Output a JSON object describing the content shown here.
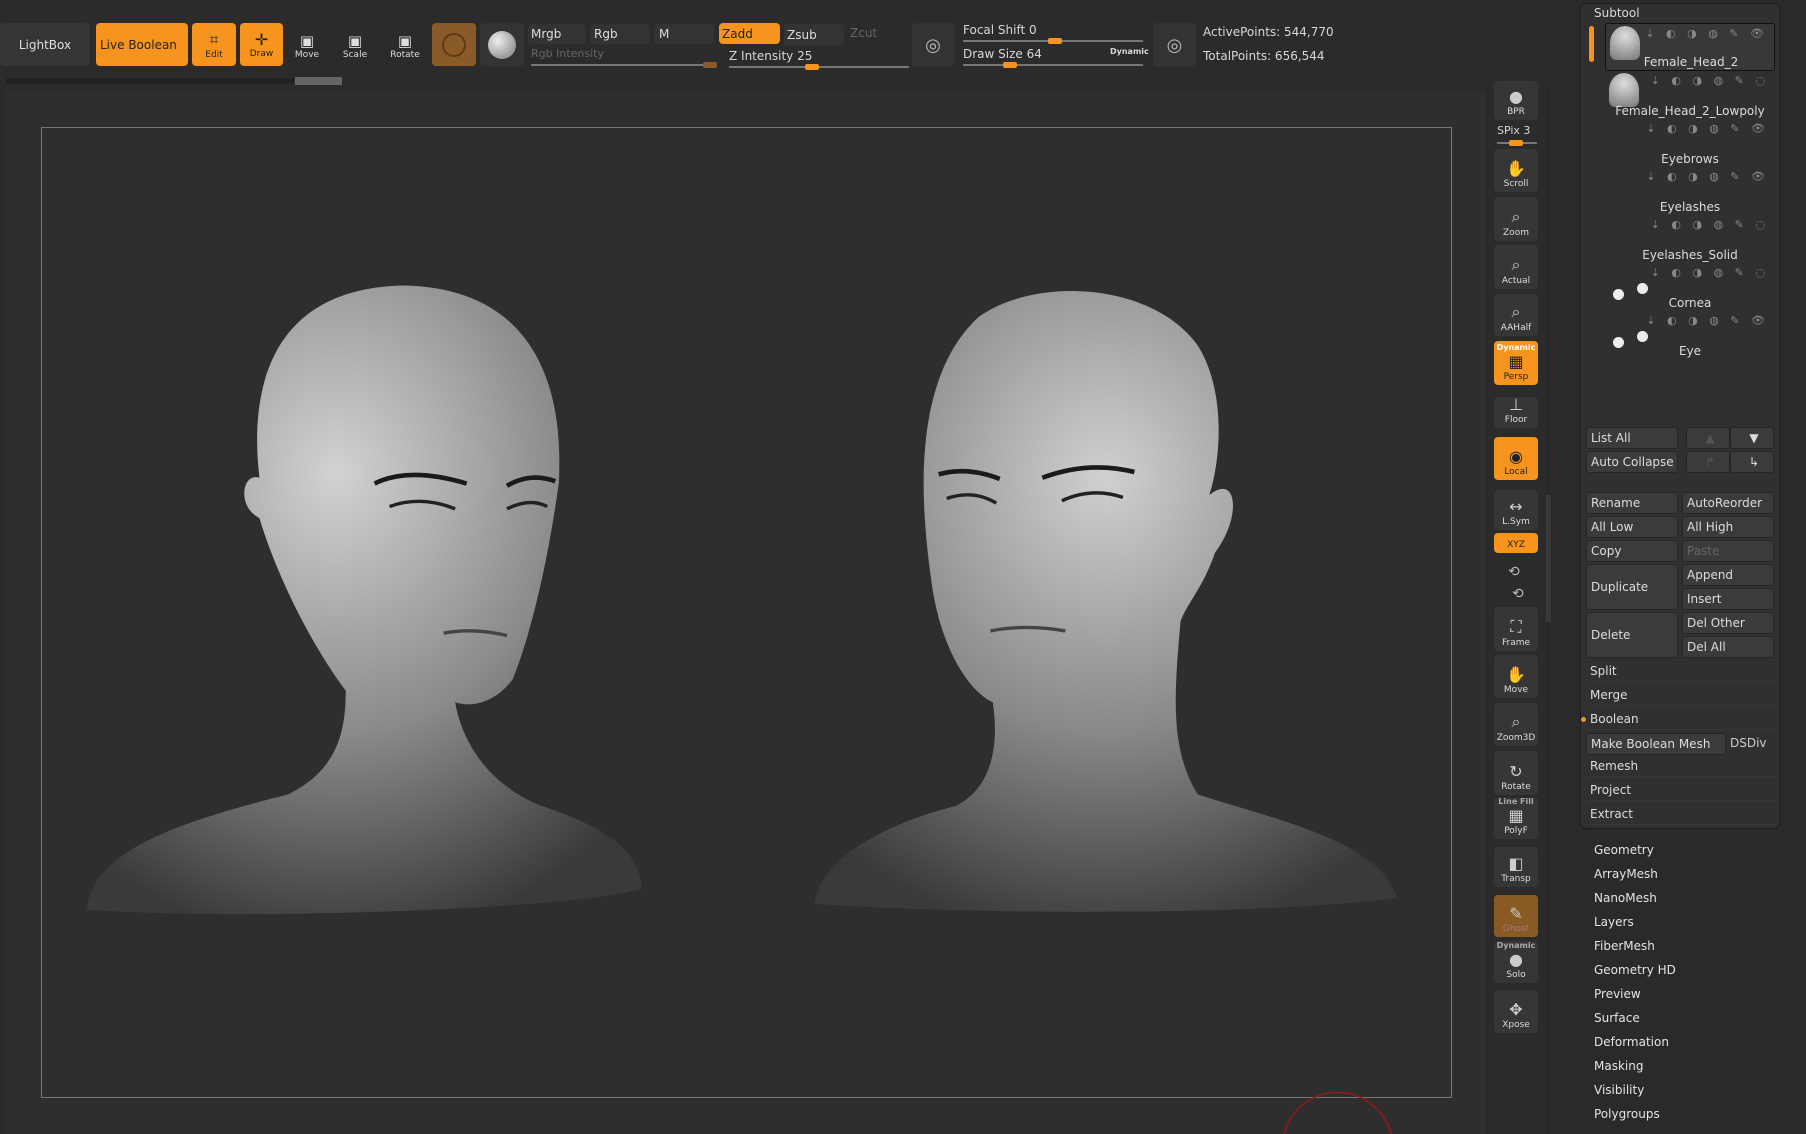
{
  "topbar": {
    "lightbox": "LightBox",
    "live_boolean": "Live Boolean",
    "edit": "Edit",
    "draw": "Draw",
    "move": "Move",
    "scale": "Scale",
    "rotate": "Rotate",
    "mrgb": "Mrgb",
    "rgb": "Rgb",
    "m": "M",
    "zadd": "Zadd",
    "zsub": "Zsub",
    "zcut": "Zcut",
    "rgb_intensity": "Rgb Intensity",
    "z_intensity": "Z Intensity 25",
    "focal_shift": "Focal Shift 0",
    "draw_size": "Draw Size 64",
    "dynamic": "Dynamic",
    "active_points": "ActivePoints: 544,770",
    "total_points": "TotalPoints: 656,544",
    "z_intensity_value": 25,
    "draw_size_value": 64,
    "focal_shift_value": 0
  },
  "right_toolbar": {
    "bpr": "BPR",
    "spix": "SPix 3",
    "scroll": "Scroll",
    "zoom": "Zoom",
    "actual": "Actual",
    "aahalf": "AAHalf",
    "persp_top": "Dynamic",
    "persp": "Persp",
    "floor": "Floor",
    "local": "Local",
    "lsym": "L.Sym",
    "xyz": "XYZ",
    "frame": "Frame",
    "move": "Move",
    "zoom3d": "Zoom3D",
    "rotate": "Rotate",
    "polyf_top": "Line Fill",
    "polyf": "PolyF",
    "transp": "Transp",
    "ghost": "Ghost",
    "solo_top": "Dynamic",
    "solo": "Solo",
    "xpose": "Xpose"
  },
  "subtool": {
    "title": "Subtool",
    "items": [
      "Female_Head_2",
      "Female_Head_2_Lowpoly",
      "Eyebrows",
      "Eyelashes",
      "Eyelashes_Solid",
      "Cornea",
      "Eye"
    ],
    "list_all": "List All",
    "auto_collapse": "Auto Collapse",
    "rename": "Rename",
    "autoreorder": "AutoReorder",
    "all_low": "All Low",
    "all_high": "All High",
    "copy": "Copy",
    "paste": "Paste",
    "duplicate": "Duplicate",
    "append": "Append",
    "insert": "Insert",
    "delete": "Delete",
    "del_other": "Del Other",
    "del_all": "Del All",
    "split": "Split",
    "merge": "Merge",
    "boolean": "Boolean",
    "make_boolean_mesh": "Make Boolean Mesh",
    "dsdiv": "DSDiv",
    "remesh": "Remesh",
    "project": "Project",
    "extract": "Extract"
  },
  "menus": [
    "Geometry",
    "ArrayMesh",
    "NanoMesh",
    "Layers",
    "FiberMesh",
    "Geometry HD",
    "Preview",
    "Surface",
    "Deformation",
    "Masking",
    "Visibility",
    "Polygroups"
  ],
  "colors": {
    "accent": "#f7941d",
    "bg": "#2a2a2a"
  }
}
